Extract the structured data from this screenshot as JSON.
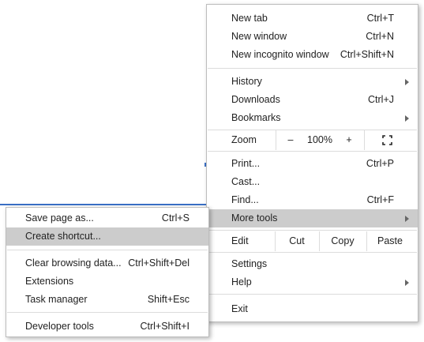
{
  "main_menu": {
    "new_tab": {
      "label": "New tab",
      "shortcut": "Ctrl+T"
    },
    "new_window": {
      "label": "New window",
      "shortcut": "Ctrl+N"
    },
    "new_incognito": {
      "label": "New incognito window",
      "shortcut": "Ctrl+Shift+N"
    },
    "history": {
      "label": "History"
    },
    "downloads": {
      "label": "Downloads",
      "shortcut": "Ctrl+J"
    },
    "bookmarks": {
      "label": "Bookmarks"
    },
    "zoom": {
      "label": "Zoom",
      "minus": "–",
      "level": "100%",
      "plus": "+"
    },
    "print": {
      "label": "Print...",
      "shortcut": "Ctrl+P"
    },
    "cast": {
      "label": "Cast..."
    },
    "find": {
      "label": "Find...",
      "shortcut": "Ctrl+F"
    },
    "more_tools": {
      "label": "More tools"
    },
    "edit": {
      "label": "Edit",
      "cut": "Cut",
      "copy": "Copy",
      "paste": "Paste"
    },
    "settings": {
      "label": "Settings"
    },
    "help": {
      "label": "Help"
    },
    "exit": {
      "label": "Exit"
    }
  },
  "sub_menu": {
    "save_page": {
      "label": "Save page as...",
      "shortcut": "Ctrl+S"
    },
    "create_shortcut": {
      "label": "Create shortcut..."
    },
    "clear_browsing": {
      "label": "Clear browsing data...",
      "shortcut": "Ctrl+Shift+Del"
    },
    "extensions": {
      "label": "Extensions"
    },
    "task_manager": {
      "label": "Task manager",
      "shortcut": "Shift+Esc"
    },
    "developer_tools": {
      "label": "Developer tools",
      "shortcut": "Ctrl+Shift+I"
    }
  },
  "colors": {
    "highlight": "#cccccc",
    "separator": "#dcdcdc"
  }
}
